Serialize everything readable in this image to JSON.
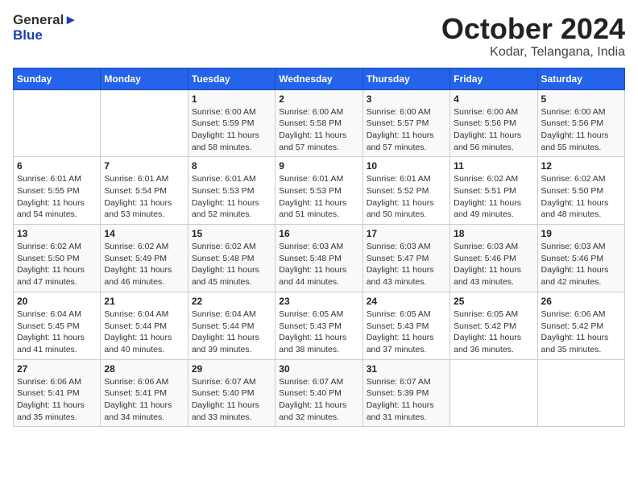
{
  "logo": {
    "general": "General",
    "blue": "Blue"
  },
  "title": "October 2024",
  "location": "Kodar, Telangana, India",
  "weekdays": [
    "Sunday",
    "Monday",
    "Tuesday",
    "Wednesday",
    "Thursday",
    "Friday",
    "Saturday"
  ],
  "weeks": [
    [
      {
        "day": "",
        "info": ""
      },
      {
        "day": "",
        "info": ""
      },
      {
        "day": "1",
        "info": "Sunrise: 6:00 AM\nSunset: 5:59 PM\nDaylight: 11 hours and 58 minutes."
      },
      {
        "day": "2",
        "info": "Sunrise: 6:00 AM\nSunset: 5:58 PM\nDaylight: 11 hours and 57 minutes."
      },
      {
        "day": "3",
        "info": "Sunrise: 6:00 AM\nSunset: 5:57 PM\nDaylight: 11 hours and 57 minutes."
      },
      {
        "day": "4",
        "info": "Sunrise: 6:00 AM\nSunset: 5:56 PM\nDaylight: 11 hours and 56 minutes."
      },
      {
        "day": "5",
        "info": "Sunrise: 6:00 AM\nSunset: 5:56 PM\nDaylight: 11 hours and 55 minutes."
      }
    ],
    [
      {
        "day": "6",
        "info": "Sunrise: 6:01 AM\nSunset: 5:55 PM\nDaylight: 11 hours and 54 minutes."
      },
      {
        "day": "7",
        "info": "Sunrise: 6:01 AM\nSunset: 5:54 PM\nDaylight: 11 hours and 53 minutes."
      },
      {
        "day": "8",
        "info": "Sunrise: 6:01 AM\nSunset: 5:53 PM\nDaylight: 11 hours and 52 minutes."
      },
      {
        "day": "9",
        "info": "Sunrise: 6:01 AM\nSunset: 5:53 PM\nDaylight: 11 hours and 51 minutes."
      },
      {
        "day": "10",
        "info": "Sunrise: 6:01 AM\nSunset: 5:52 PM\nDaylight: 11 hours and 50 minutes."
      },
      {
        "day": "11",
        "info": "Sunrise: 6:02 AM\nSunset: 5:51 PM\nDaylight: 11 hours and 49 minutes."
      },
      {
        "day": "12",
        "info": "Sunrise: 6:02 AM\nSunset: 5:50 PM\nDaylight: 11 hours and 48 minutes."
      }
    ],
    [
      {
        "day": "13",
        "info": "Sunrise: 6:02 AM\nSunset: 5:50 PM\nDaylight: 11 hours and 47 minutes."
      },
      {
        "day": "14",
        "info": "Sunrise: 6:02 AM\nSunset: 5:49 PM\nDaylight: 11 hours and 46 minutes."
      },
      {
        "day": "15",
        "info": "Sunrise: 6:02 AM\nSunset: 5:48 PM\nDaylight: 11 hours and 45 minutes."
      },
      {
        "day": "16",
        "info": "Sunrise: 6:03 AM\nSunset: 5:48 PM\nDaylight: 11 hours and 44 minutes."
      },
      {
        "day": "17",
        "info": "Sunrise: 6:03 AM\nSunset: 5:47 PM\nDaylight: 11 hours and 43 minutes."
      },
      {
        "day": "18",
        "info": "Sunrise: 6:03 AM\nSunset: 5:46 PM\nDaylight: 11 hours and 43 minutes."
      },
      {
        "day": "19",
        "info": "Sunrise: 6:03 AM\nSunset: 5:46 PM\nDaylight: 11 hours and 42 minutes."
      }
    ],
    [
      {
        "day": "20",
        "info": "Sunrise: 6:04 AM\nSunset: 5:45 PM\nDaylight: 11 hours and 41 minutes."
      },
      {
        "day": "21",
        "info": "Sunrise: 6:04 AM\nSunset: 5:44 PM\nDaylight: 11 hours and 40 minutes."
      },
      {
        "day": "22",
        "info": "Sunrise: 6:04 AM\nSunset: 5:44 PM\nDaylight: 11 hours and 39 minutes."
      },
      {
        "day": "23",
        "info": "Sunrise: 6:05 AM\nSunset: 5:43 PM\nDaylight: 11 hours and 38 minutes."
      },
      {
        "day": "24",
        "info": "Sunrise: 6:05 AM\nSunset: 5:43 PM\nDaylight: 11 hours and 37 minutes."
      },
      {
        "day": "25",
        "info": "Sunrise: 6:05 AM\nSunset: 5:42 PM\nDaylight: 11 hours and 36 minutes."
      },
      {
        "day": "26",
        "info": "Sunrise: 6:06 AM\nSunset: 5:42 PM\nDaylight: 11 hours and 35 minutes."
      }
    ],
    [
      {
        "day": "27",
        "info": "Sunrise: 6:06 AM\nSunset: 5:41 PM\nDaylight: 11 hours and 35 minutes."
      },
      {
        "day": "28",
        "info": "Sunrise: 6:06 AM\nSunset: 5:41 PM\nDaylight: 11 hours and 34 minutes."
      },
      {
        "day": "29",
        "info": "Sunrise: 6:07 AM\nSunset: 5:40 PM\nDaylight: 11 hours and 33 minutes."
      },
      {
        "day": "30",
        "info": "Sunrise: 6:07 AM\nSunset: 5:40 PM\nDaylight: 11 hours and 32 minutes."
      },
      {
        "day": "31",
        "info": "Sunrise: 6:07 AM\nSunset: 5:39 PM\nDaylight: 11 hours and 31 minutes."
      },
      {
        "day": "",
        "info": ""
      },
      {
        "day": "",
        "info": ""
      }
    ]
  ]
}
